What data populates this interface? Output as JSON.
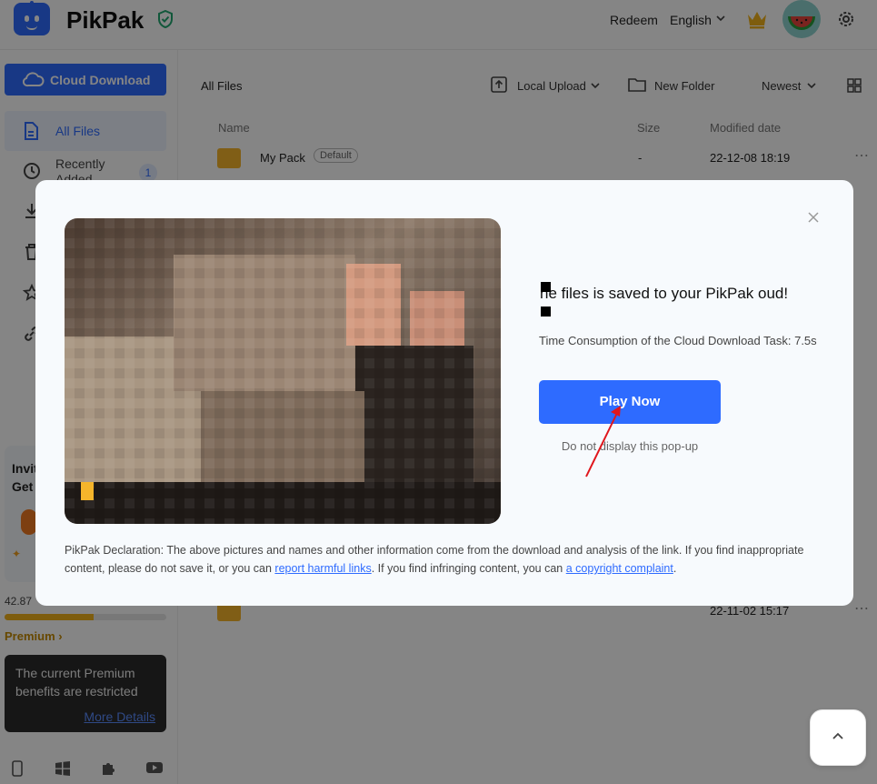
{
  "header": {
    "brand": "PikPak",
    "redeem": "Redeem",
    "language": "English",
    "icons": [
      "shield-check-icon",
      "chevron-down-icon",
      "crown-icon",
      "avatar",
      "gear-icon"
    ]
  },
  "sidebar": {
    "cloud_download": "Cloud Download",
    "items": [
      {
        "label": "All Files",
        "icon": "file-icon"
      },
      {
        "label": "Recently Added",
        "icon": "clock-icon",
        "badge": "1"
      },
      {
        "label": "",
        "icon": "download-icon"
      },
      {
        "label": "",
        "icon": "trash-icon"
      },
      {
        "label": "",
        "icon": "star-icon"
      },
      {
        "label": "",
        "icon": "link-icon"
      }
    ],
    "invite_line1": "Invit",
    "invite_line2": "Get",
    "storage_text": "42.87",
    "storage_fraction": 0.55,
    "premium_link": "Premium",
    "tooltip_text": "The current Premium benefits are restricted",
    "tooltip_link": "More Details",
    "apps": [
      "phone-icon",
      "windows-icon",
      "extension-icon",
      "youtube-icon"
    ]
  },
  "main": {
    "breadcrumb": "All Files",
    "toolbar": {
      "local_upload": "Local Upload",
      "new_folder": "New Folder",
      "sort": "Newest"
    },
    "columns": {
      "name": "Name",
      "size": "Size",
      "modified": "Modified date"
    },
    "rows": [
      {
        "name": "My Pack",
        "tag": "Default",
        "size": "-",
        "date": "22-12-08 18:19"
      },
      {
        "name": "",
        "tag": "",
        "size": "",
        "date": "22-11-02 15:17"
      }
    ]
  },
  "modal": {
    "title": "he files is saved to your PikPak oud!",
    "subtitle": "Time Consumption of the Cloud Download Task: 7.5s",
    "play_button": "Play Now",
    "no_display": "Do not display this pop-up",
    "declaration_prefix": "PikPak Declaration:",
    "declaration_text_1": " The above pictures and names and other information come from the download and analysis of the link. If you find inappropriate content, please do not save it, or you can ",
    "declaration_link_1": "report harmful links",
    "declaration_text_2": ". If you find infringing content, you can ",
    "declaration_link_2": "a copyright complaint",
    "declaration_text_3": "."
  },
  "colors": {
    "accent": "#2e6bff",
    "premium": "#c58a00",
    "folder": "#f5b52b",
    "arrow": "#e0161c"
  }
}
